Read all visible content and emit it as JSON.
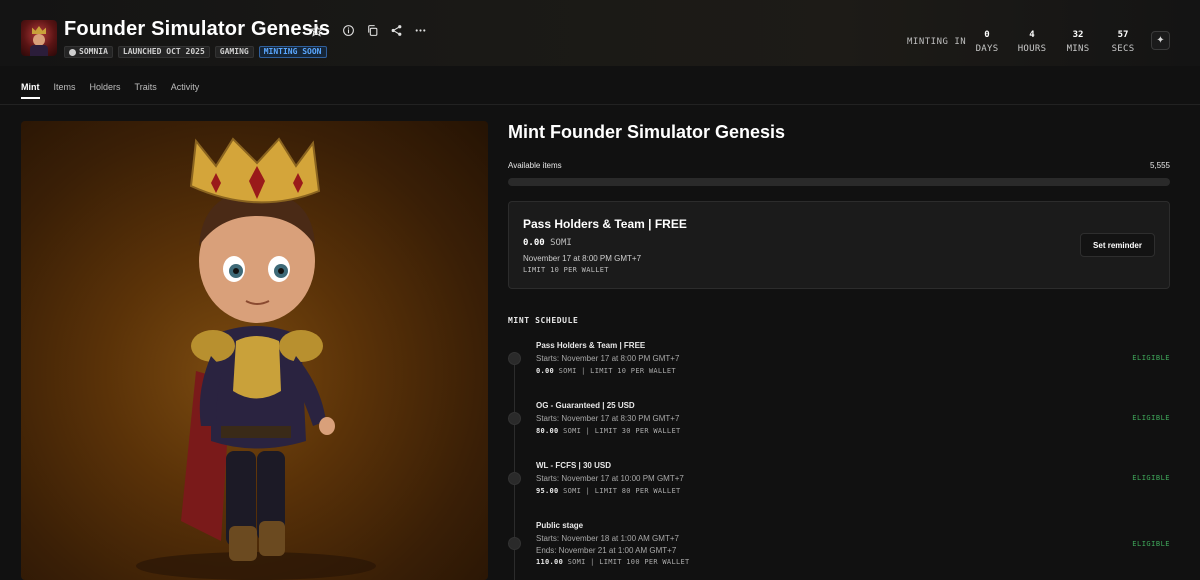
{
  "header": {
    "title": "Founder Simulator Genesis",
    "icons": [
      "star-icon",
      "info-icon",
      "copy-icon",
      "share-icon",
      "more-icon"
    ],
    "badges": [
      {
        "label": "SOMNIA",
        "icon": "network-icon"
      },
      {
        "label": "LAUNCHED OCT 2025"
      },
      {
        "label": "GAMING"
      },
      {
        "label": "MINTING SOON",
        "accent": "#5aa7ff"
      }
    ],
    "minting_in_label": "MINTING IN",
    "countdown": [
      {
        "value": "0",
        "label": "DAYS"
      },
      {
        "value": "4",
        "label": "HOURS"
      },
      {
        "value": "32",
        "label": "MINS"
      },
      {
        "value": "57",
        "label": "SECS"
      }
    ],
    "expand_icon": "sparkle-icon"
  },
  "tabs": [
    {
      "label": "Mint",
      "active": true
    },
    {
      "label": "Items"
    },
    {
      "label": "Holders"
    },
    {
      "label": "Traits"
    },
    {
      "label": "Activity"
    }
  ],
  "mint": {
    "title": "Mint Founder Simulator Genesis",
    "available_label": "Available items",
    "available_count": "5,555",
    "progress_fraction": 0,
    "current_stage": {
      "name": "Pass Holders & Team | FREE",
      "price": "0.00",
      "currency": "SOMI",
      "date": "November 17 at 8:00 PM GMT+7",
      "limit": "LIMIT 10 PER WALLET",
      "reminder_label": "Set reminder"
    },
    "schedule_title": "MINT SCHEDULE",
    "schedule": [
      {
        "name": "Pass Holders & Team | FREE",
        "lines": [
          "Starts: November 17 at 8:00 PM GMT+7"
        ],
        "price": "0.00",
        "price_rest": "SOMI | LIMIT 10 PER WALLET",
        "status": "ELIGIBLE"
      },
      {
        "name": "OG - Guaranteed | 25 USD",
        "lines": [
          "Starts: November 17 at 8:30 PM GMT+7"
        ],
        "price": "80.00",
        "price_rest": "SOMI | LIMIT 30 PER WALLET",
        "status": "ELIGIBLE"
      },
      {
        "name": "WL - FCFS | 30 USD",
        "lines": [
          "Starts: November 17 at 10:00 PM GMT+7"
        ],
        "price": "95.00",
        "price_rest": "SOMI | LIMIT 80 PER WALLET",
        "status": "ELIGIBLE"
      },
      {
        "name": "Public stage",
        "lines": [
          "Starts: November 18 at 1:00 AM GMT+7",
          "Ends: November 21 at 1:00 AM GMT+7"
        ],
        "price": "110.00",
        "price_rest": "SOMI | LIMIT 100 PER WALLET",
        "status": "ELIGIBLE"
      }
    ]
  },
  "colors": {
    "eligible": "#3fa75a",
    "minting_soon": "#5aa7ff",
    "background": "#111111"
  }
}
